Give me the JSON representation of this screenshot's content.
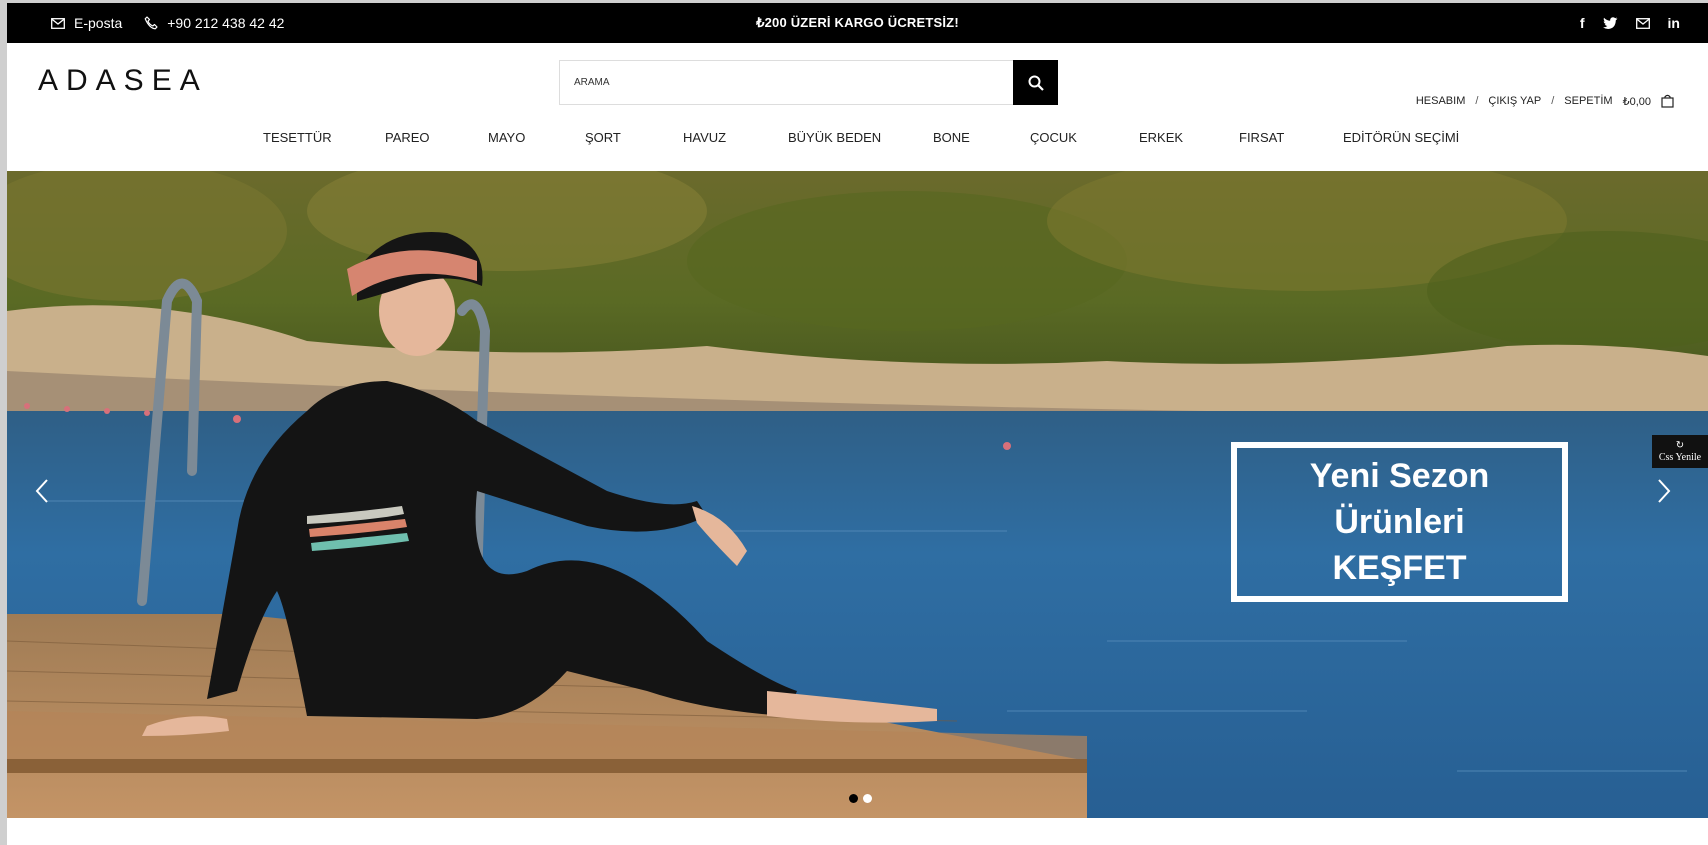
{
  "topbar": {
    "email_label": "E-posta",
    "phone_label": "+90 212 438 42 42",
    "promo_text": "₺200 ÜZERİ KARGO ÜCRETSİZ!",
    "social": [
      "facebook-icon",
      "twitter-icon",
      "mail-icon",
      "linkedin-icon"
    ]
  },
  "header": {
    "logo": "ADASEA",
    "search_placeholder": "ARAMA",
    "account": {
      "my_account": "HESABIM",
      "logout": "ÇIKIŞ YAP",
      "cart": "SEPETİM",
      "cart_total": "₺0,00",
      "separator": "/"
    }
  },
  "nav": {
    "items": [
      {
        "label": "TESETTÜR"
      },
      {
        "label": "PAREO"
      },
      {
        "label": "MAYO"
      },
      {
        "label": "ŞORT"
      },
      {
        "label": "HAVUZ"
      },
      {
        "label": "BÜYÜK BEDEN"
      },
      {
        "label": "BONE"
      },
      {
        "label": "ÇOCUK"
      },
      {
        "label": "ERKEK"
      },
      {
        "label": "FIRSAT"
      },
      {
        "label": "EDİTÖRÜN SEÇİMİ"
      }
    ]
  },
  "hero": {
    "line1": "Yeni Sezon",
    "line2": "Ürünleri",
    "line3": "KEŞFET",
    "slide_count": 2,
    "active_slide": 1
  },
  "widget": {
    "css_refresh_label": "Css Yenile"
  },
  "colors": {
    "topbar": "#000000",
    "sea": "#2d6a9a",
    "text": "#222222",
    "white": "#ffffff"
  }
}
